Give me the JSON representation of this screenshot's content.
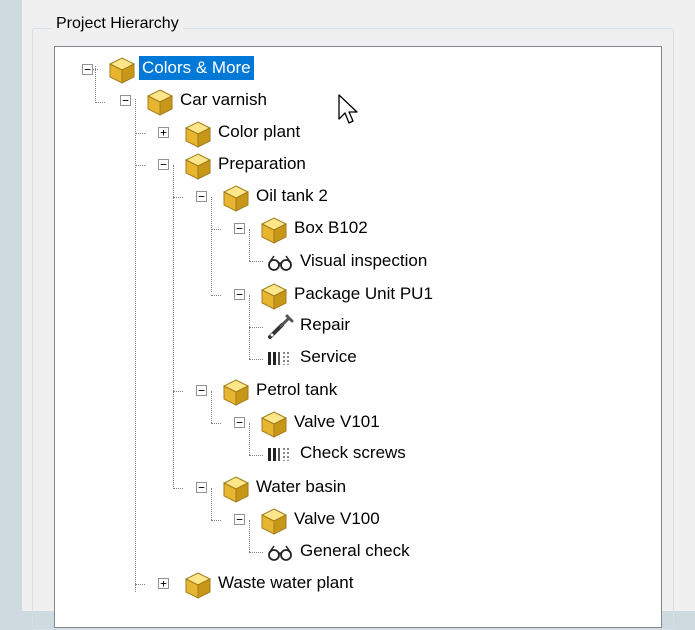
{
  "group": {
    "title": "Project Hierarchy"
  },
  "tree": {
    "nodes": [
      {
        "label": "Colors & More",
        "icon": "cube-icon",
        "expanded": true,
        "selected": true
      },
      {
        "label": "Car varnish",
        "icon": "cube-icon",
        "expanded": true
      },
      {
        "label": "Color plant",
        "icon": "cube-icon",
        "expanded": false
      },
      {
        "label": "Preparation",
        "icon": "cube-icon",
        "expanded": true
      },
      {
        "label": "Oil tank 2",
        "icon": "cube-icon",
        "expanded": true
      },
      {
        "label": "Box B102",
        "icon": "cube-icon",
        "expanded": true
      },
      {
        "label": "Visual inspection",
        "icon": "glasses-icon"
      },
      {
        "label": "Package Unit PU1",
        "icon": "cube-icon",
        "expanded": true
      },
      {
        "label": "Repair",
        "icon": "wrench-icon"
      },
      {
        "label": "Service",
        "icon": "toolbox-icon"
      },
      {
        "label": "Petrol tank",
        "icon": "cube-icon",
        "expanded": true
      },
      {
        "label": "Valve V101",
        "icon": "cube-icon",
        "expanded": true
      },
      {
        "label": "Check screws",
        "icon": "toolbox-icon"
      },
      {
        "label": "Water basin",
        "icon": "cube-icon",
        "expanded": true
      },
      {
        "label": "Valve V100",
        "icon": "cube-icon",
        "expanded": true
      },
      {
        "label": "General check",
        "icon": "glasses-icon"
      },
      {
        "label": "Waste water plant",
        "icon": "cube-icon",
        "expanded": false
      }
    ]
  },
  "colors": {
    "selection": "#0078d7",
    "cube": "#f2c54a"
  }
}
